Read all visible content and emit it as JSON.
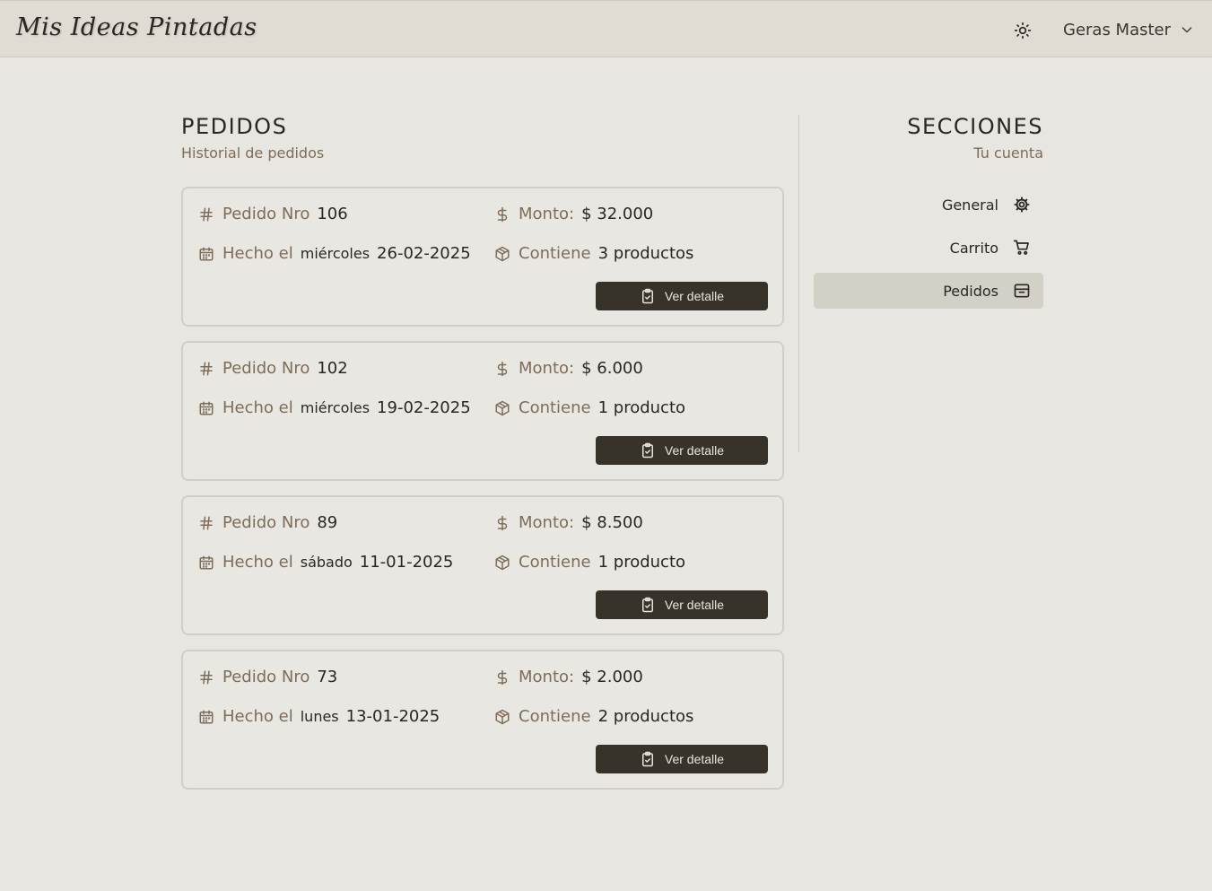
{
  "header": {
    "logo_text": "Mis Ideas Pintadas",
    "theme_icon": "sun-icon",
    "user_name": "Geras Master",
    "user_menu_icon": "chevron-down-icon"
  },
  "main": {
    "title": "PEDIDOS",
    "subtitle": "Historial de pedidos",
    "order_label": "Pedido Nro",
    "amount_label": "Monto:",
    "date_label": "Hecho el",
    "contains_label": "Contiene",
    "detail_button_label": "Ver detalle",
    "orders": [
      {
        "number": "106",
        "amount": "$ 32.000",
        "weekday": "miércoles",
        "date": "26-02-2025",
        "products": "3 productos"
      },
      {
        "number": "102",
        "amount": "$ 6.000",
        "weekday": "miércoles",
        "date": "19-02-2025",
        "products": "1 producto"
      },
      {
        "number": "89",
        "amount": "$ 8.500",
        "weekday": "sábado",
        "date": "11-01-2025",
        "products": "1 producto"
      },
      {
        "number": "73",
        "amount": "$ 2.000",
        "weekday": "lunes",
        "date": "13-01-2025",
        "products": "2 productos"
      }
    ]
  },
  "sidebar": {
    "title": "SECCIONES",
    "subtitle": "Tu cuenta",
    "items": [
      {
        "label": "General",
        "icon": "gear-icon",
        "active": false
      },
      {
        "label": "Carrito",
        "icon": "cart-icon",
        "active": false
      },
      {
        "label": "Pedidos",
        "icon": "archive-icon",
        "active": true
      }
    ]
  },
  "colors": {
    "background": "#e8e6e1",
    "header": "#e0dcd3",
    "accent_dark": "#38332a",
    "muted_label": "#7d6d58",
    "active_item": "#d3d0c7"
  }
}
